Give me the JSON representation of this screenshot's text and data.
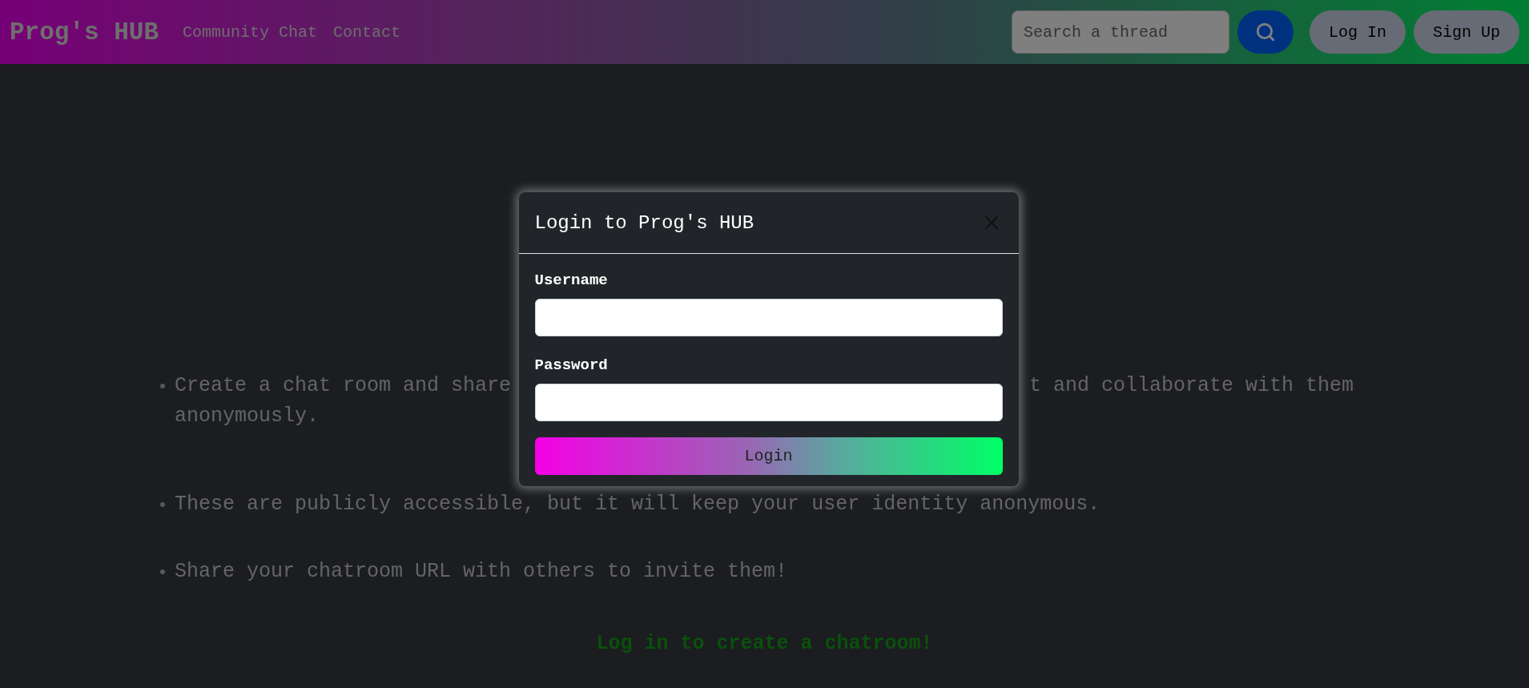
{
  "navbar": {
    "brand": "Prog's HUB",
    "links": [
      "Community Chat",
      "Contact"
    ],
    "search": {
      "placeholder": "Search a thread"
    },
    "buttons": [
      "Log In",
      "Sign Up"
    ]
  },
  "bullets": [
    {
      "lines": [
        [
          "Create a chat room and share",
          "t and collaborate with them"
        ],
        [
          "anonymously."
        ]
      ]
    },
    {
      "lines": [
        [
          "These are publicly accessible, but it will keep your user identity anonymous."
        ]
      ]
    },
    {
      "lines": [
        [
          "Share your chatroom URL with others to invite them!"
        ]
      ]
    }
  ],
  "cta": "Log in to create a chatroom!",
  "modal": {
    "title": "Login to Prog's HUB",
    "fields": [
      {
        "label": "Username"
      },
      {
        "label": "Password"
      }
    ],
    "submit": "Login"
  }
}
